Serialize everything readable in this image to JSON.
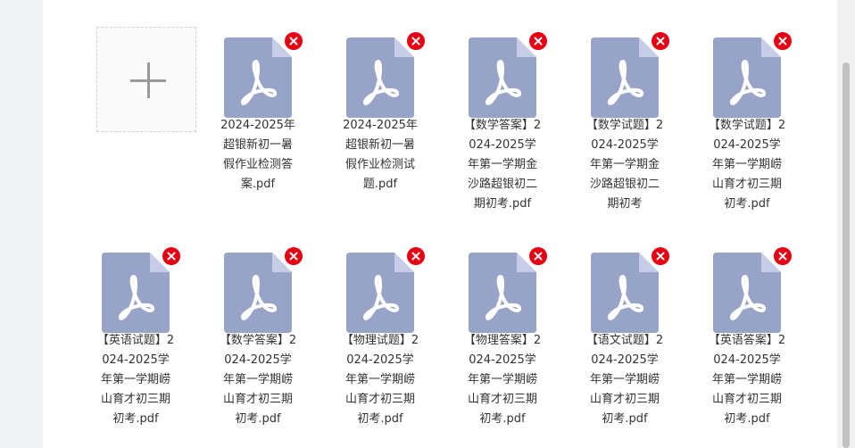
{
  "upload": {
    "add_icon": "plus-icon"
  },
  "file_icon": "pdf-file-icon",
  "remove_icon": "close-icon",
  "colors": {
    "file_icon_body": "#98a3c8",
    "file_icon_fold": "#c7cde6",
    "remove_button": "#e60012",
    "text": "#333333"
  },
  "files": [
    {
      "name": "2024-2025年超银新初一暑假作业检测答案.pdf"
    },
    {
      "name": "2024-2025年超银新初一暑假作业检测试题.pdf"
    },
    {
      "name": "【数学答案】2024-2025学年第一学期金沙路超银初二期初考.pdf"
    },
    {
      "name": "【数学试题】2024-2025学年第一学期金沙路超银初二期初考"
    },
    {
      "name": "【数学试题】2024-2025学年第一学期崂山育才初三期初考.pdf"
    },
    {
      "name": "【英语试题】2024-2025学年第一学期崂山育才初三期初考.pdf"
    },
    {
      "name": "【数学答案】2024-2025学年第一学期崂山育才初三期初考.pdf"
    },
    {
      "name": "【物理试题】2024-2025学年第一学期崂山育才初三期初考.pdf"
    },
    {
      "name": "【物理答案】2024-2025学年第一学期崂山育才初三期初考.pdf"
    },
    {
      "name": "【语文试题】2024-2025学年第一学期崂山育才初三期初考.pdf"
    },
    {
      "name": "【英语答案】2024-2025学年第一学期崂山育才初三期初考.pdf"
    }
  ]
}
